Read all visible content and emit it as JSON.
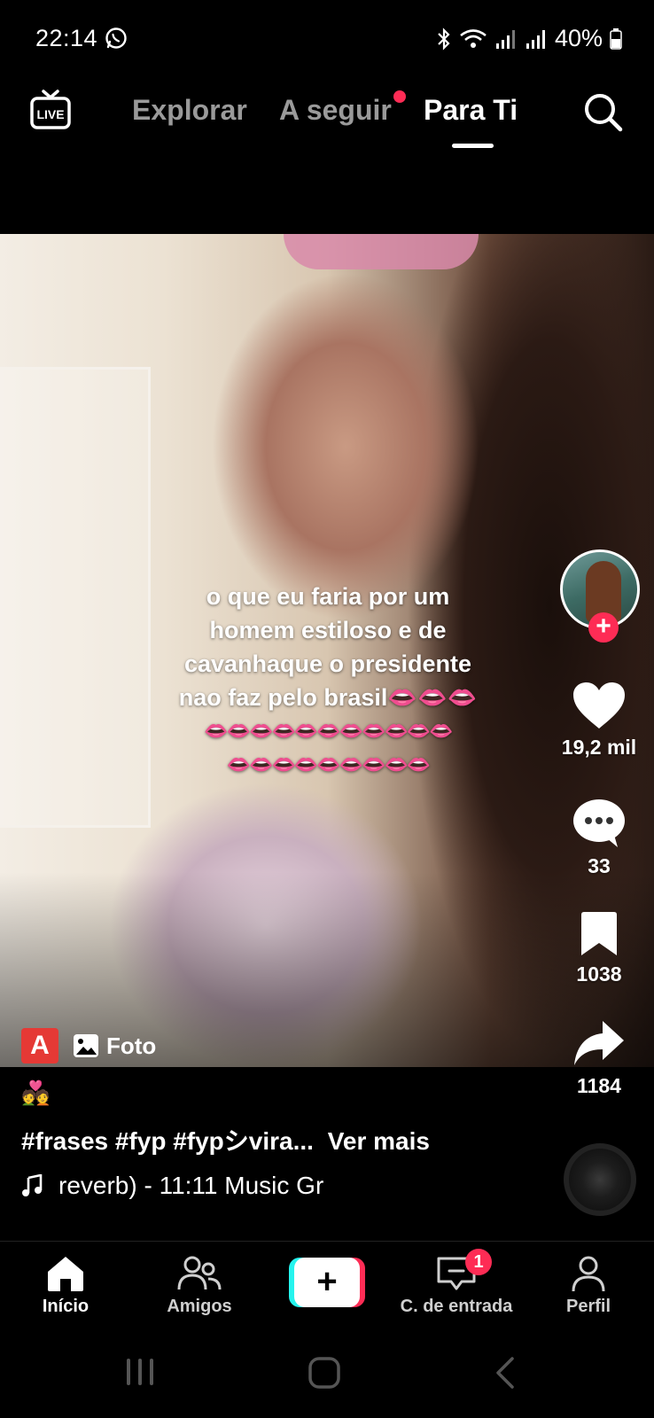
{
  "status_bar": {
    "time": "22:14",
    "battery": "40%"
  },
  "top_nav": {
    "tabs": [
      {
        "label": "Explorar"
      },
      {
        "label": "A seguir"
      },
      {
        "label": "Para Ti"
      }
    ],
    "active_tab": "Para Ti"
  },
  "video": {
    "caption_lines": [
      "o que eu faria por um",
      "homem estiloso e de",
      "cavanhaque o presidente",
      "nao faz pelo brasil👄👄👄",
      "👄👄👄👄👄👄👄👄👄👄👄",
      "👄👄👄👄👄👄👄👄👄"
    ],
    "badge_a": "A",
    "photo_label": "Foto"
  },
  "actions": {
    "likes": "19,2 mil",
    "comments": "33",
    "saves": "1038",
    "shares": "1184",
    "follow_symbol": "+"
  },
  "post": {
    "emoji": "💑",
    "hashtags": "#frases #fyp #fypシvira...",
    "see_more": "Ver mais",
    "music": "reverb) - 11:11 Music Gr"
  },
  "bottom_nav": {
    "home": "Início",
    "friends": "Amigos",
    "create": "+",
    "inbox": "C. de entrada",
    "inbox_badge": "1",
    "profile": "Perfil"
  },
  "colors": {
    "accent": "#fe2c55",
    "cyan": "#25f4ee",
    "background": "#000000"
  }
}
